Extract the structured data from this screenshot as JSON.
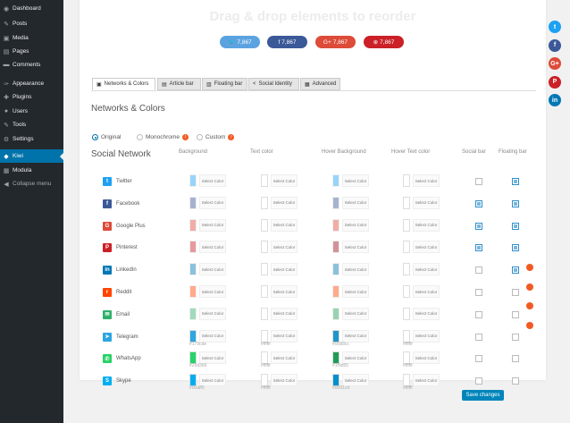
{
  "sidebar": {
    "items": [
      {
        "label": "Dashboard",
        "icon": "dashboard-icon",
        "glyph": "◉"
      },
      {
        "label": "Posts",
        "icon": "pin-icon",
        "glyph": "✎"
      },
      {
        "label": "Media",
        "icon": "media-icon",
        "glyph": "▣"
      },
      {
        "label": "Pages",
        "icon": "pages-icon",
        "glyph": "▤"
      },
      {
        "label": "Comments",
        "icon": "comments-icon",
        "glyph": "▬"
      },
      {
        "label": "Appearance",
        "icon": "brush-icon",
        "glyph": "✑"
      },
      {
        "label": "Plugins",
        "icon": "plugin-icon",
        "glyph": "✚"
      },
      {
        "label": "Users",
        "icon": "users-icon",
        "glyph": "●"
      },
      {
        "label": "Tools",
        "icon": "tools-icon",
        "glyph": "✎"
      },
      {
        "label": "Settings",
        "icon": "settings-icon",
        "glyph": "⚙"
      },
      {
        "label": "Kiwi",
        "icon": "kiwi-icon",
        "glyph": "◆",
        "active": true
      },
      {
        "label": "Modula",
        "icon": "modula-icon",
        "glyph": "▦"
      },
      {
        "label": "Collapse menu",
        "icon": "collapse-icon",
        "glyph": "◀"
      }
    ]
  },
  "header": {
    "drag_title": "Drag & drop elements to reorder",
    "share_buttons": [
      {
        "network": "twitter",
        "glyph": "🐦",
        "count": "7,867",
        "color": "#5ba3e0"
      },
      {
        "network": "facebook",
        "glyph": "f",
        "count": "7,867",
        "color": "#3b5998"
      },
      {
        "network": "googleplus",
        "glyph": "G+",
        "count": "7,867",
        "color": "#dd4b39"
      },
      {
        "network": "pinterest",
        "glyph": "⊕",
        "count": "7,867",
        "color": "#cb2027"
      }
    ]
  },
  "tabs": [
    {
      "label": "Networks & Colors",
      "icon": "networks-icon",
      "glyph": "▣",
      "active": true
    },
    {
      "label": "Article bar",
      "icon": "article-bar-icon",
      "glyph": "▤"
    },
    {
      "label": "Floating bar",
      "icon": "floating-bar-icon",
      "glyph": "▥"
    },
    {
      "label": "Social Identity",
      "icon": "share-icon",
      "glyph": "<"
    },
    {
      "label": "Advanced",
      "icon": "advanced-icon",
      "glyph": "▦"
    }
  ],
  "section_title": "Networks & Colors",
  "color_modes": [
    {
      "label": "Original",
      "checked": true,
      "pro": false
    },
    {
      "label": "Monochrome",
      "checked": false,
      "pro": true
    },
    {
      "label": "Custom",
      "checked": false,
      "pro": true
    }
  ],
  "pro_badge": "!",
  "columns": {
    "social_network": "Social Network",
    "background": "Background",
    "text_color": "Text color",
    "hover_background": "Hover Background",
    "hover_text_color": "Hover Text color",
    "social_bar": "Social bar",
    "floating_bar": "Floating bar"
  },
  "select_color_label": "Select Color",
  "networks": [
    {
      "name": "Twitter",
      "glyph": "t",
      "icon_color": "#1da1f2",
      "bg": "#1da1f2",
      "hover_bg": "#1da1f2",
      "bg_hex": "",
      "hover_hex": "",
      "social_bar": false,
      "floating_bar": true,
      "lock": false
    },
    {
      "name": "Facebook",
      "glyph": "f",
      "icon_color": "#3b5998",
      "bg": "#3b5998",
      "hover_bg": "#3b5998",
      "bg_hex": "",
      "hover_hex": "",
      "social_bar": true,
      "floating_bar": true,
      "lock": false
    },
    {
      "name": "Google Plus",
      "glyph": "G",
      "icon_color": "#dd4b39",
      "bg": "#dd4b39",
      "hover_bg": "#dd4b39",
      "bg_hex": "",
      "hover_hex": "",
      "social_bar": true,
      "floating_bar": true,
      "lock": false
    },
    {
      "name": "Pinterest",
      "glyph": "P",
      "icon_color": "#cb2027",
      "bg": "#cb2027",
      "hover_bg": "#a00f1c",
      "bg_hex": "",
      "hover_hex": "",
      "social_bar": true,
      "floating_bar": true,
      "lock": false
    },
    {
      "name": "LinkedIn",
      "glyph": "in",
      "icon_color": "#0077b5",
      "bg": "#0077b5",
      "hover_bg": "#0077b5",
      "bg_hex": "",
      "hover_hex": "",
      "social_bar": false,
      "floating_bar": true,
      "lock": true
    },
    {
      "name": "Reddit",
      "glyph": "r",
      "icon_color": "#ff4500",
      "bg": "#ff4500",
      "hover_bg": "#ff4500",
      "bg_hex": "",
      "hover_hex": "",
      "social_bar": false,
      "floating_bar": false,
      "lock": true
    },
    {
      "name": "Email",
      "glyph": "✉",
      "icon_color": "#2fb06a",
      "bg": "#2fb06a",
      "hover_bg": "#1f9d55",
      "bg_hex": "",
      "hover_hex": "",
      "social_bar": false,
      "floating_bar": false,
      "lock": true
    },
    {
      "name": "Telegram",
      "glyph": "➤",
      "icon_color": "#2ca5e0",
      "bg": "#2ca5e0",
      "hover_bg": "#1e96c8",
      "bg_hex": "#179cde",
      "hover_hex": "#0088cc",
      "social_bar": false,
      "floating_bar": false,
      "lock": true
    },
    {
      "name": "WhatsApp",
      "glyph": "✆",
      "icon_color": "#25d366",
      "bg": "#25d366",
      "hover_bg": "#1f9d55",
      "bg_hex": "#25d366",
      "hover_hex": "#1f9d55",
      "social_bar": false,
      "floating_bar": false,
      "lock": false
    },
    {
      "name": "Skype",
      "glyph": "S",
      "icon_color": "#00aff0",
      "bg": "#00aff0",
      "hover_bg": "#0091cd",
      "bg_hex": "#00aff0",
      "hover_hex": "#0091cd",
      "social_bar": false,
      "floating_bar": false,
      "lock": false
    }
  ],
  "white_hex": "#ffffff",
  "save_label": "Save changes",
  "floating_bar": [
    {
      "network": "twitter",
      "glyph": "t",
      "color": "#1da1f2"
    },
    {
      "network": "facebook",
      "glyph": "f",
      "color": "#3b5998"
    },
    {
      "network": "googleplus",
      "glyph": "G+",
      "color": "#dd4b39"
    },
    {
      "network": "pinterest",
      "glyph": "P",
      "color": "#cb2027"
    },
    {
      "network": "linkedin",
      "glyph": "in",
      "color": "#0077b5"
    }
  ]
}
